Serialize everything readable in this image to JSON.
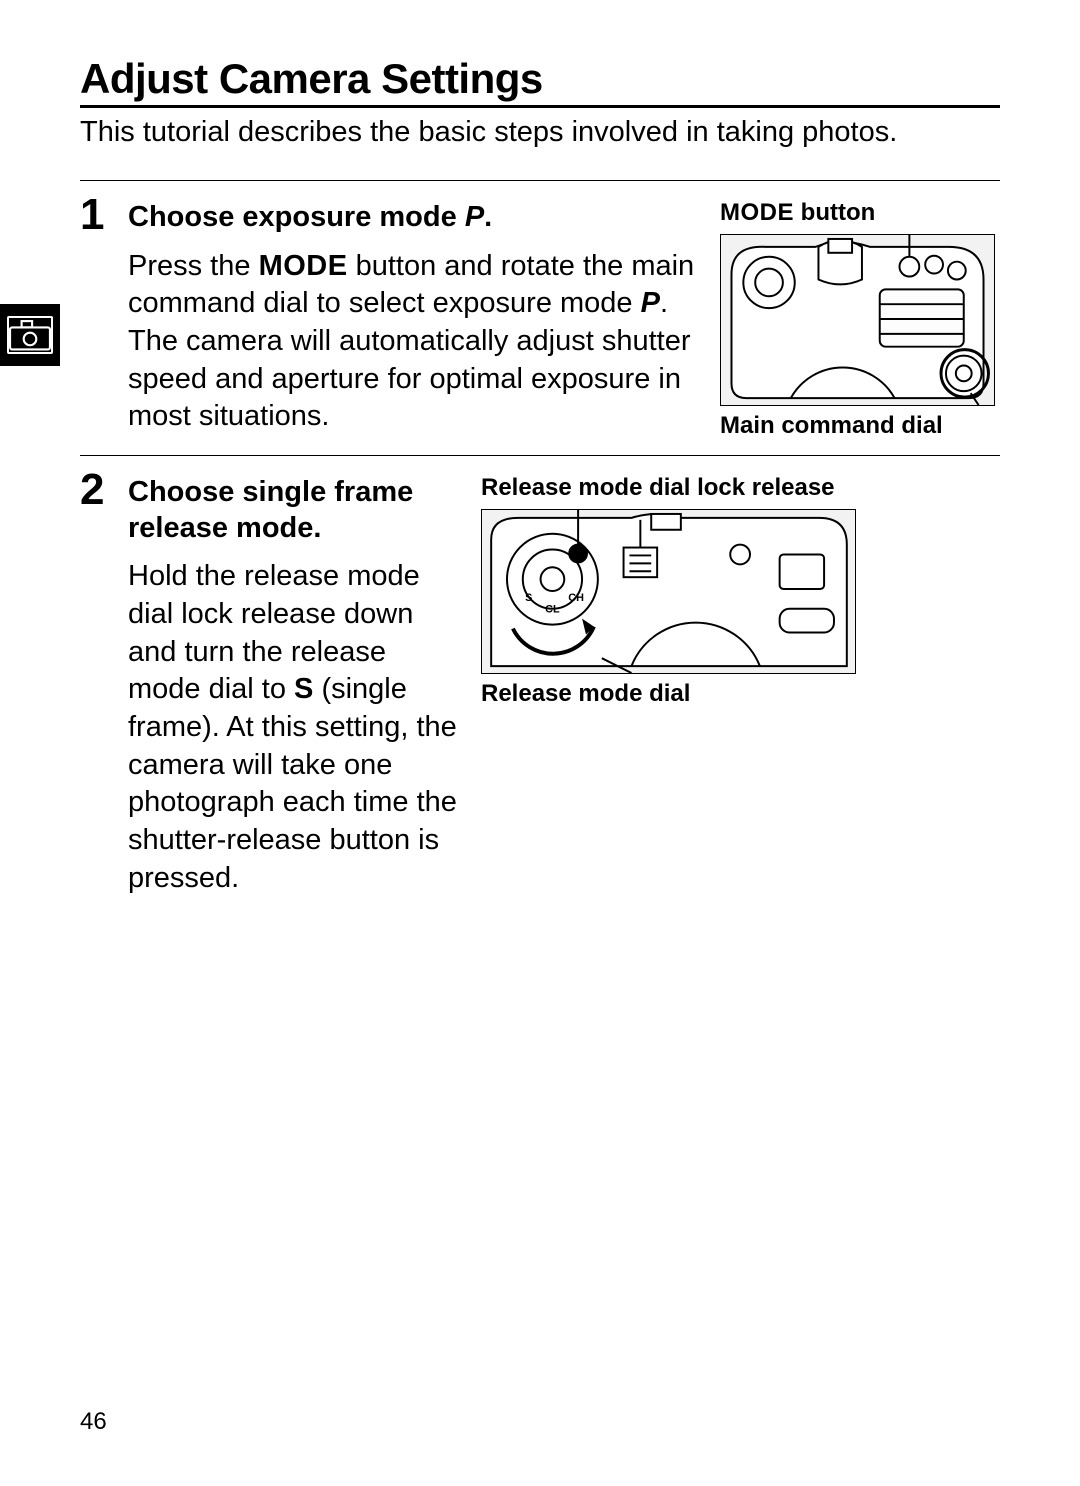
{
  "page_number": "46",
  "title": "Adjust Camera Settings",
  "intro": "This tutorial describes the basic steps involved in taking photos.",
  "steps": [
    {
      "num": "1",
      "heading_pre": "Choose exposure mode ",
      "heading_glyph": "P",
      "heading_post": ".",
      "body_parts": {
        "a": "Press the ",
        "mode": "MODE",
        "b": " button and rotate the main command dial to select exposure mode ",
        "p": "P",
        "c": ".  The camera will automatically adjust shutter speed and aperture for optimal exposure in most situations."
      },
      "fig": {
        "top_label_mode": "MODE",
        "top_label_rest": " button",
        "bottom_label": "Main command dial"
      }
    },
    {
      "num": "2",
      "heading": "Choose single frame release mode.",
      "body_parts": {
        "a": "Hold the release mode dial lock release down and turn the release mode dial to ",
        "s": "S",
        "b": " (single frame).  At this setting, the camera will take one photograph each time the shutter-release button is pressed."
      },
      "fig": {
        "top_label": "Release mode dial lock release",
        "bottom_label": "Release mode dial"
      }
    }
  ],
  "side_tab_icon": "camera-icon"
}
